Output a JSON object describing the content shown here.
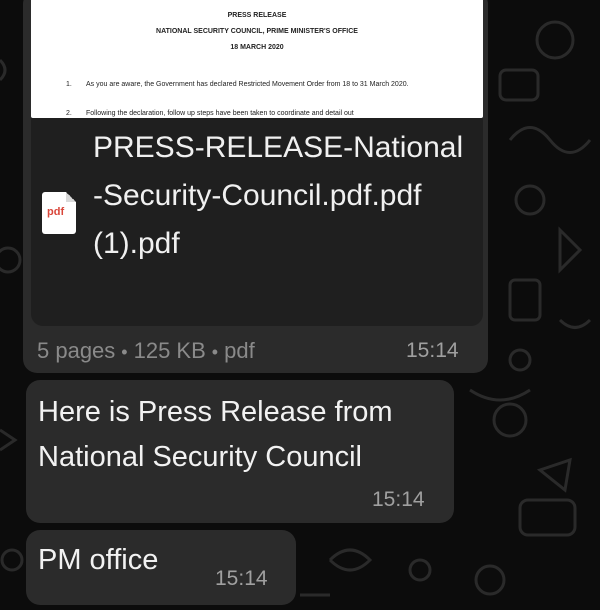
{
  "document_message": {
    "preview": {
      "heading": "PRESS RELEASE",
      "org": "NATIONAL SECURITY COUNCIL, PRIME MINISTER'S OFFICE",
      "date": "18 MARCH 2020",
      "para1_num": "1.",
      "para1_text": "As you are aware, the Government has declared Restricted Movement Order from 18 to 31 March 2020.",
      "para2_num": "2.",
      "para2_text": "Following the declaration, follow up steps have been taken to coordinate and detail out"
    },
    "file_icon_label": "pdf",
    "file_name": "PRESS-RELEASE-National-Security-Council.pdf.pdf (1).pdf",
    "pages": "5 pages",
    "size": "125 KB",
    "type": "pdf",
    "time": "15:14"
  },
  "messages": [
    {
      "text": "Here is Press Release from National Security Council",
      "time": "15:14"
    },
    {
      "text": "PM office",
      "time": "15:14"
    }
  ]
}
